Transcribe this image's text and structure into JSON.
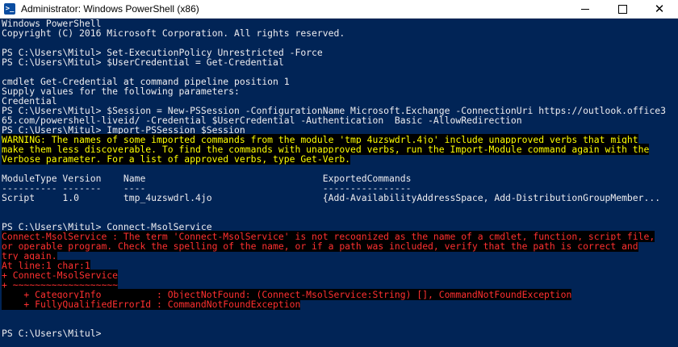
{
  "window": {
    "title": "Administrator: Windows PowerShell (x86)",
    "icon": "powershell-icon",
    "minimize_symbol": "",
    "maximize_symbol": "",
    "close_symbol": "✕"
  },
  "colors": {
    "console_bg": "#012456",
    "console_fg": "#eeedf0",
    "warning_fg": "#ffff00",
    "error_fg": "#ff3030",
    "highlight_bg": "#000000"
  },
  "console": {
    "lines": [
      {
        "text": "Windows PowerShell",
        "kind": "normal"
      },
      {
        "text": "Copyright (C) 2016 Microsoft Corporation. All rights reserved.",
        "kind": "normal"
      },
      {
        "text": "",
        "kind": "normal"
      },
      {
        "text": "PS C:\\Users\\Mitul> Set-ExecutionPolicy Unrestricted -Force",
        "kind": "normal"
      },
      {
        "text": "PS C:\\Users\\Mitul> $UserCredential = Get-Credential",
        "kind": "normal"
      },
      {
        "text": "",
        "kind": "normal"
      },
      {
        "text": "cmdlet Get-Credential at command pipeline position 1",
        "kind": "normal"
      },
      {
        "text": "Supply values for the following parameters:",
        "kind": "normal"
      },
      {
        "text": "Credential",
        "kind": "normal"
      },
      {
        "text": "PS C:\\Users\\Mitul> $Session = New-PSSession -ConfigurationName Microsoft.Exchange -ConnectionUri https://outlook.office3",
        "kind": "normal"
      },
      {
        "text": "65.com/powershell-liveid/ -Credential $UserCredential -Authentication  Basic -AllowRedirection",
        "kind": "normal"
      },
      {
        "text": "PS C:\\Users\\Mitul> Import-PSSession $Session",
        "kind": "normal"
      },
      {
        "text": "WARNING: The names of some imported commands from the module 'tmp_4uzswdrl.4jo' include unapproved verbs that might",
        "kind": "warning"
      },
      {
        "text": "make them less discoverable. To find the commands with unapproved verbs, run the Import-Module command again with the",
        "kind": "warning"
      },
      {
        "text": "Verbose parameter. For a list of approved verbs, type Get-Verb.",
        "kind": "warning"
      },
      {
        "text": "",
        "kind": "normal"
      },
      {
        "text": "ModuleType Version    Name                                ExportedCommands",
        "kind": "normal"
      },
      {
        "text": "---------- -------    ----                                ----------------",
        "kind": "normal"
      },
      {
        "text": "Script     1.0        tmp_4uzswdrl.4jo                    {Add-AvailabilityAddressSpace, Add-DistributionGroupMember...",
        "kind": "normal"
      },
      {
        "text": "",
        "kind": "normal"
      },
      {
        "text": "",
        "kind": "normal"
      },
      {
        "text": "PS C:\\Users\\Mitul> Connect-MsolService",
        "kind": "normal"
      },
      {
        "text": "Connect-MsolService : The term 'Connect-MsolService' is not recognized as the name of a cmdlet, function, script file,",
        "kind": "error"
      },
      {
        "text": "or operable program. Check the spelling of the name, or if a path was included, verify that the path is correct and",
        "kind": "error"
      },
      {
        "text": "try again.",
        "kind": "error"
      },
      {
        "text": "At line:1 char:1",
        "kind": "error"
      },
      {
        "text": "+ Connect-MsolService",
        "kind": "error"
      },
      {
        "text": "+ ~~~~~~~~~~~~~~~~~~~",
        "kind": "error"
      },
      {
        "text": "    + CategoryInfo          : ObjectNotFound: (Connect-MsolService:String) [], CommandNotFoundException",
        "kind": "error"
      },
      {
        "text": "    + FullyQualifiedErrorId : CommandNotFoundException",
        "kind": "error"
      },
      {
        "text": "",
        "kind": "normal"
      },
      {
        "text": "",
        "kind": "normal"
      },
      {
        "text": "PS C:\\Users\\Mitul>",
        "kind": "normal"
      }
    ]
  }
}
